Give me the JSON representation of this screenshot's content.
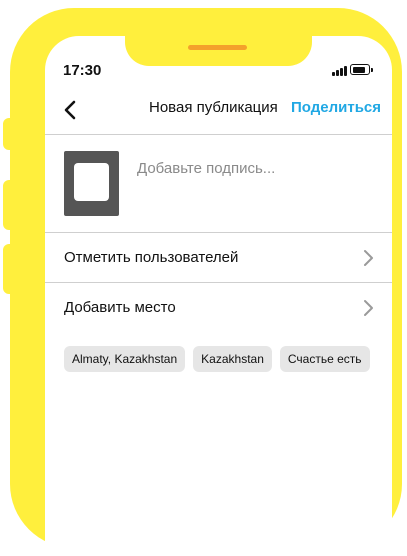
{
  "status_bar": {
    "time": "17:30"
  },
  "header": {
    "title": "Новая публикация",
    "share_label": "Поделиться"
  },
  "caption": {
    "placeholder": "Добавьте подпись...",
    "value": ""
  },
  "rows": [
    {
      "label": "Отметить пользователей"
    },
    {
      "label": "Добавить место"
    }
  ],
  "tags": [
    {
      "label": "Almaty, Kazakhstan"
    },
    {
      "label": "Kazakhstan"
    },
    {
      "label": "Счастье есть"
    }
  ],
  "colors": {
    "frame": "#FFEF3D",
    "speaker": "#F4A12B",
    "accent": "#21A8E4"
  }
}
